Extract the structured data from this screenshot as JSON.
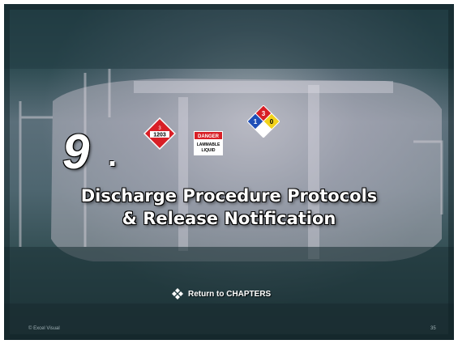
{
  "slide": {
    "chapter_number": "9",
    "chapter_dot": ".",
    "title_line1": "Discharge Procedure Protocols",
    "title_line2": "& Release Notification"
  },
  "navigation": {
    "return_label": "Return to CHAPTERS",
    "return_icon": "diamond-cluster-icon"
  },
  "footer": {
    "copyright": "© Excel Visual",
    "page_number": "35"
  },
  "placard": {
    "un_number": "1203",
    "hazard_class": "3",
    "label_line1": "DANGER",
    "label_line2": "LAMMABLE",
    "label_line3": "LIQUID",
    "nfpa_health": "1",
    "nfpa_flammability": "3",
    "nfpa_reactivity": "0"
  },
  "colors": {
    "placard_red": "#d81f26",
    "nfpa_blue": "#1f4fb8",
    "nfpa_yellow": "#f2d21a",
    "nfpa_white": "#ffffff",
    "text": "#ffffff"
  }
}
